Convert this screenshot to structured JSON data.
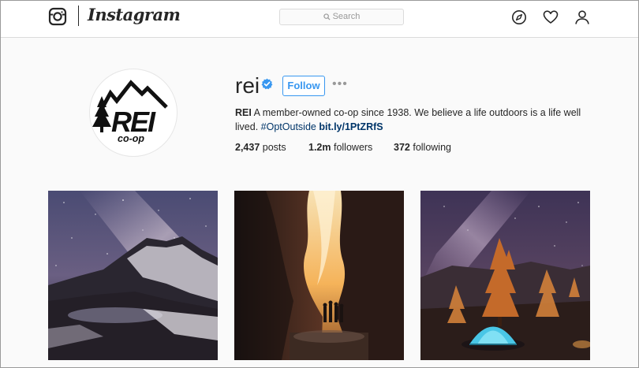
{
  "nav": {
    "wordmark": "Instagram",
    "search_placeholder": "Search",
    "icons": [
      "instagram-glyph-icon",
      "search-icon",
      "compass-icon",
      "heart-icon",
      "person-icon"
    ]
  },
  "profile": {
    "username": "rei",
    "verified": true,
    "follow_label": "Follow",
    "more_label": "•••",
    "avatar_logo_text": "REI CO-OP",
    "bio": {
      "name": "REI",
      "text": "A member-owned co-op since 1938. We believe a life outdoors is a life well lived.",
      "hashtag": "#OptOutside",
      "link": "bit.ly/1PtZRfS"
    },
    "stats": {
      "posts_count": "2,437",
      "posts_label": "posts",
      "followers_count": "1.2m",
      "followers_label": "followers",
      "following_count": "372",
      "following_label": "following"
    }
  },
  "posts": [
    {
      "subject": "milky way over snowy mountain and lake"
    },
    {
      "subject": "people in glowing slot canyon"
    },
    {
      "subject": "lit tent under pine trees at night"
    }
  ],
  "colors": {
    "accent": "#3897f0",
    "link": "#003569",
    "text": "#262626",
    "background": "#fafafa"
  }
}
